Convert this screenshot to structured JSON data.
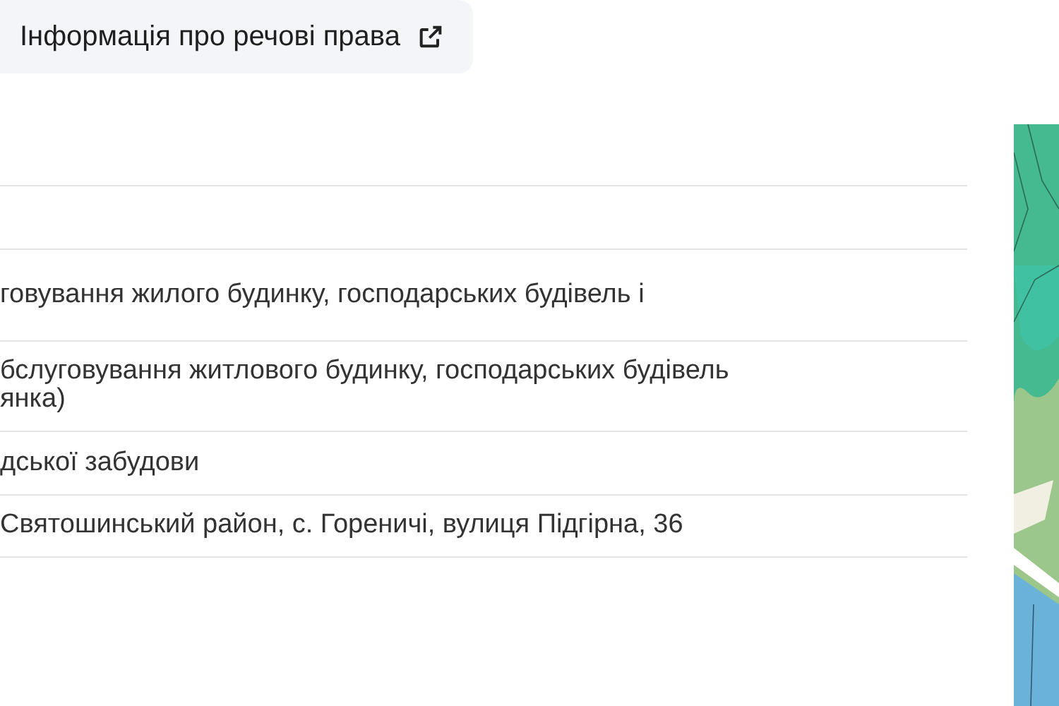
{
  "header_button": {
    "label": "Інформація про речові права"
  },
  "rows": [
    {
      "text": "говування жилого будинку, господарських будівель і"
    },
    {
      "text": "бслуговування житлового будинку, господарських будівель\nянка)"
    },
    {
      "text": "дської забудови"
    },
    {
      "text": "Святошинський район, с. Гореничі, вулиця Підгірна, 36"
    }
  ]
}
